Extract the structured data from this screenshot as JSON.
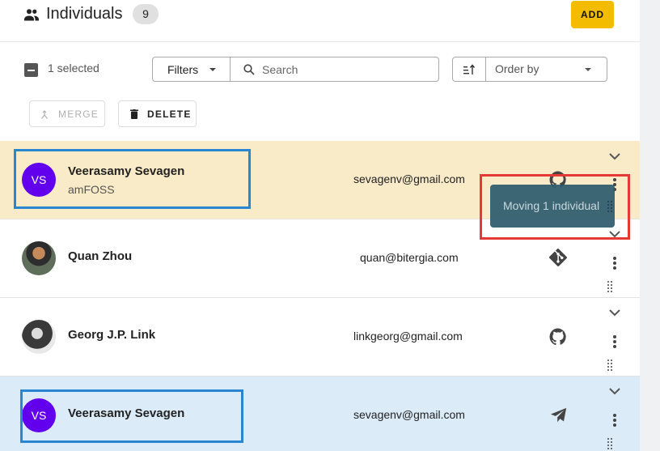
{
  "header": {
    "title": "Individuals",
    "count": "9",
    "add_label": "ADD"
  },
  "toolbar": {
    "selected_text": "1 selected",
    "filters_label": "Filters",
    "search_placeholder": "Search",
    "search_value": "",
    "order_placeholder": "Order by",
    "merge_label": "MERGE",
    "delete_label": "DELETE"
  },
  "rows": [
    {
      "name": "Veerasamy Sevagen",
      "org": "amFOSS",
      "email": "sevagenv@gmail.com",
      "avatar_initials": "VS",
      "source_icon": "github-icon",
      "state": "dragging"
    },
    {
      "name": "Quan Zhou",
      "org": "",
      "email": "quan@bitergia.com",
      "avatar_initials": "",
      "source_icon": "git-icon",
      "state": "normal"
    },
    {
      "name": "Georg J.P. Link",
      "org": "",
      "email": "linkgeorg@gmail.com",
      "avatar_initials": "",
      "source_icon": "github-icon",
      "state": "normal"
    },
    {
      "name": "Veerasamy Sevagen",
      "org": "",
      "email": "sevagenv@gmail.com",
      "avatar_initials": "VS",
      "source_icon": "telegram-icon",
      "state": "drop-target"
    }
  ],
  "drag_toast": "Moving 1 individual",
  "colors": {
    "accent": "#f4bc00",
    "dragging_row": "#f9ebc7",
    "drop_row": "#dbecf8",
    "avatar": "#6200ee",
    "highlight_blue": "#2b86d1",
    "highlight_red": "#e53935"
  }
}
